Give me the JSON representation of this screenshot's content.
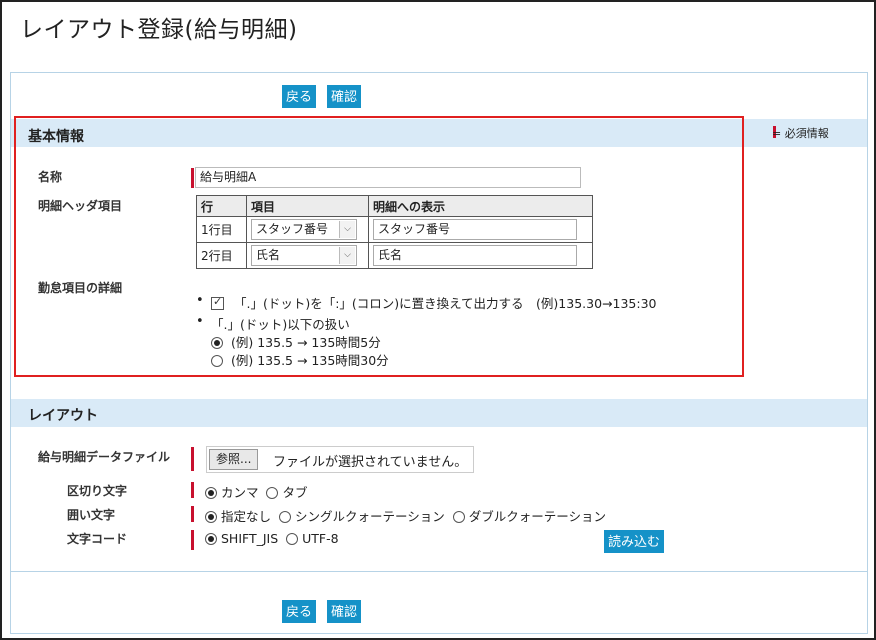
{
  "page": {
    "title": "レイアウト登録(給与明細)"
  },
  "toolbar": {
    "back_label": "戻る",
    "confirm_label": "確認"
  },
  "basic_info": {
    "section_title": "基本情報",
    "required_legend": "= 必須情報",
    "name_label": "名称",
    "name_value": "給与明細A",
    "header_items_label": "明細ヘッダ項目",
    "table": {
      "headers": [
        "行",
        "項目",
        "明細への表示"
      ],
      "rows": [
        {
          "row": "1行目",
          "item": "スタッフ番号",
          "display": "スタッフ番号"
        },
        {
          "row": "2行目",
          "item": "氏名",
          "display": "氏名"
        }
      ]
    },
    "attendance_label": "勤怠項目の詳細",
    "option_replace": "「.」(ドット)を「:」(コロン)に置き換えて出力する　(例)135.30→135:30",
    "option_below_dot": "「.」(ドット)以下の扱い",
    "radio_example_1": "(例) 135.5 → 135時間5分",
    "radio_example_2": "(例) 135.5 → 135時間30分"
  },
  "layout": {
    "section_title": "レイアウト",
    "file_label": "給与明細データファイル",
    "browse_label": "参照...",
    "file_status": "ファイルが選択されていません。",
    "delimiter_label": "区切り文字",
    "delimiter_options": [
      "カンマ",
      "タブ"
    ],
    "enclosure_label": "囲い文字",
    "enclosure_options": [
      "指定なし",
      "シングルクォーテーション",
      "ダブルクォーテーション"
    ],
    "encoding_label": "文字コード",
    "encoding_options": [
      "SHIFT_JIS",
      "UTF-8"
    ],
    "load_label": "読み込む"
  }
}
